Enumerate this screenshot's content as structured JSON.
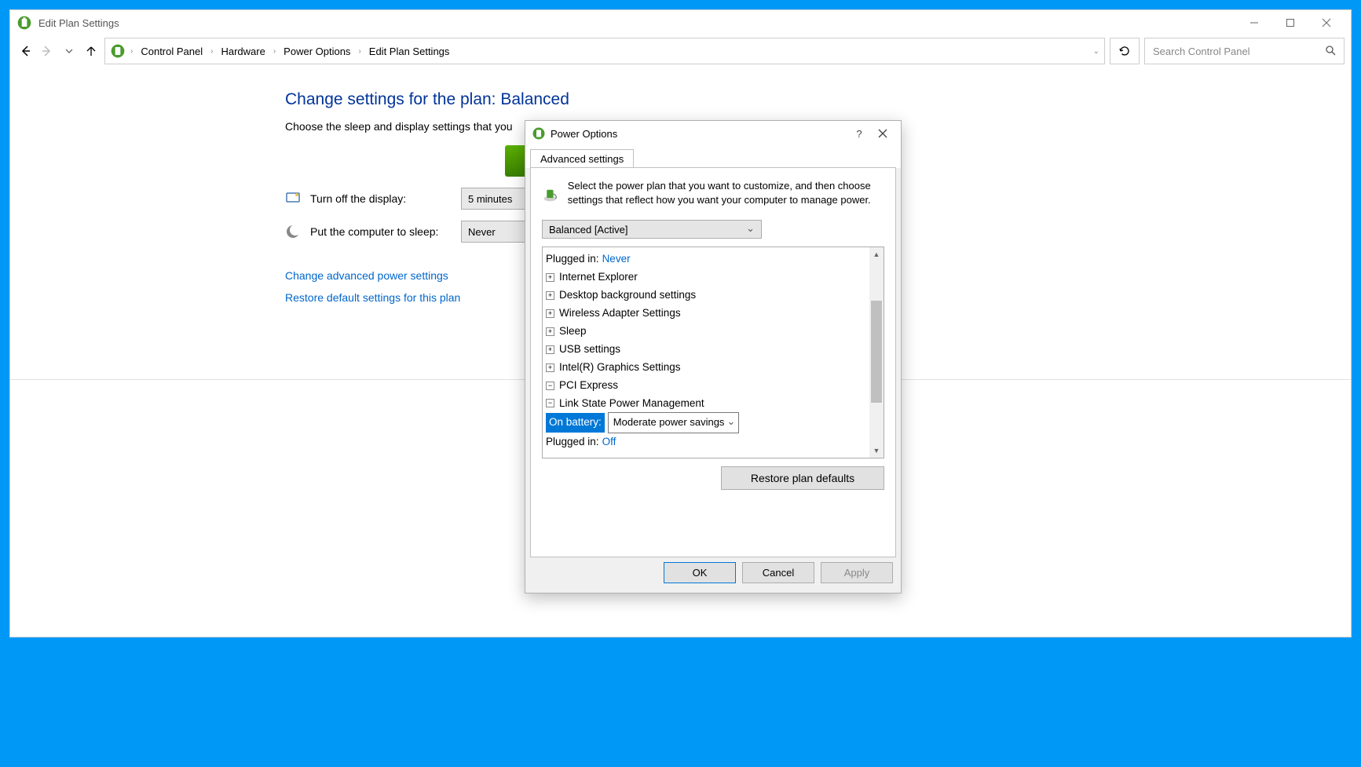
{
  "window": {
    "title": "Edit Plan Settings"
  },
  "breadcrumb": {
    "items": [
      "Control Panel",
      "Hardware",
      "Power Options",
      "Edit Plan Settings"
    ]
  },
  "search": {
    "placeholder": "Search Control Panel"
  },
  "page": {
    "heading": "Change settings for the plan: Balanced",
    "description": "Choose the sleep and display settings that you",
    "turn_off_label": "Turn off the display:",
    "turn_off_value": "5 minutes",
    "sleep_label": "Put the computer to sleep:",
    "sleep_value": "Never",
    "link_advanced": "Change advanced power settings",
    "link_restore": "Restore default settings for this plan"
  },
  "dialog": {
    "title": "Power Options",
    "tab": "Advanced settings",
    "description": "Select the power plan that you want to customize, and then choose settings that reflect how you want your computer to manage power.",
    "plan": "Balanced [Active]",
    "tree": {
      "top_label": "Plugged in:",
      "top_value": "Never",
      "items": [
        "Internet Explorer",
        "Desktop background settings",
        "Wireless Adapter Settings",
        "Sleep",
        "USB settings",
        "Intel(R) Graphics Settings",
        "PCI Express"
      ],
      "pci_sub": "Link State Power Management",
      "on_battery_label": "On battery:",
      "on_battery_value": "Moderate power savings",
      "plugged_in_label": "Plugged in:",
      "plugged_in_value": "Off"
    },
    "restore_btn": "Restore plan defaults",
    "ok": "OK",
    "cancel": "Cancel",
    "apply": "Apply"
  }
}
